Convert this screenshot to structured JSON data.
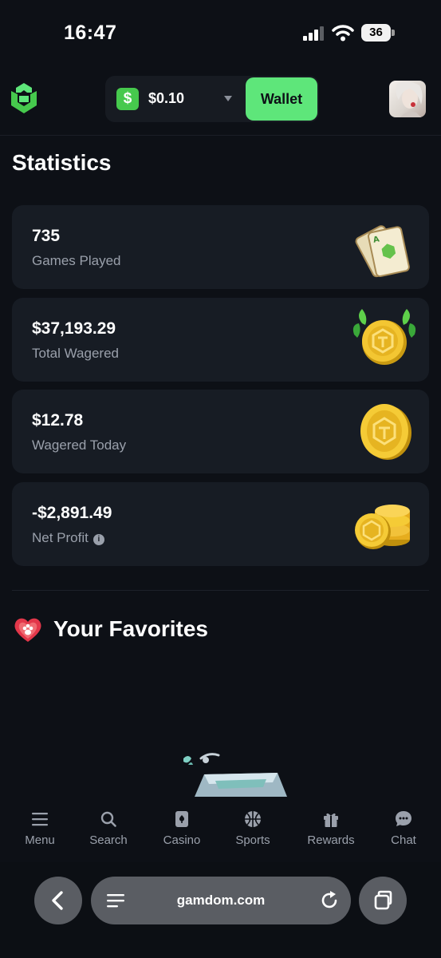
{
  "status_bar": {
    "time": "16:47",
    "battery": "36"
  },
  "header": {
    "balance": "$0.10",
    "currency_symbol": "$",
    "wallet_label": "Wallet"
  },
  "statistics": {
    "title": "Statistics",
    "cards": [
      {
        "value": "735",
        "label": "Games Played",
        "icon": "cards-icon"
      },
      {
        "value": "$37,193.29",
        "label": "Total Wagered",
        "icon": "coin-leaves-icon"
      },
      {
        "value": "$12.78",
        "label": "Wagered Today",
        "icon": "coin-icon"
      },
      {
        "value": "-$2,891.49",
        "label": "Net Profit",
        "icon": "coin-stack-icon"
      }
    ],
    "info_glyph": "i"
  },
  "favorites": {
    "title": "Your Favorites"
  },
  "bottom_nav": {
    "items": [
      {
        "label": "Menu",
        "icon": "menu-icon"
      },
      {
        "label": "Search",
        "icon": "search-icon"
      },
      {
        "label": "Casino",
        "icon": "casino-icon"
      },
      {
        "label": "Sports",
        "icon": "sports-icon"
      },
      {
        "label": "Rewards",
        "icon": "gift-icon"
      },
      {
        "label": "Chat",
        "icon": "chat-icon"
      }
    ]
  },
  "browser": {
    "url": "gamdom.com"
  },
  "colors": {
    "background": "#0d1016",
    "card": "#171c24",
    "accent_green": "#5ee67a",
    "muted_text": "#9aa0ab"
  }
}
